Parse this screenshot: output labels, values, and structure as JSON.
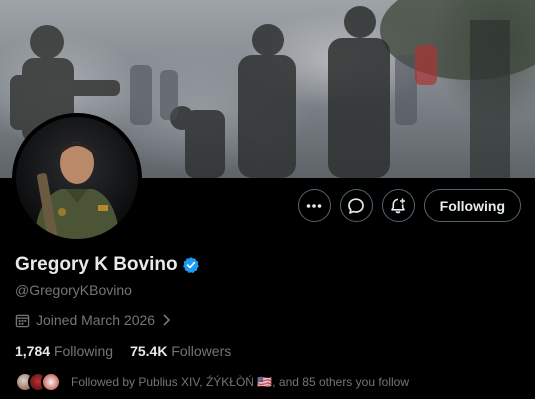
{
  "header": {
    "banner_icon": "banner-photo",
    "avatar_icon": "profile-photo"
  },
  "actions": {
    "more_icon": "more-icon",
    "message_icon": "message-icon",
    "notify_icon": "notification-add-icon",
    "following_label": "Following"
  },
  "profile": {
    "display_name": "Gregory K Bovino",
    "verified_icon": "verified-badge-icon",
    "handle": "@GregoryKBovino",
    "joined": "Joined March 2026",
    "following_count": "1,784",
    "following_label": "Following",
    "followers_count": "75.4K",
    "followers_label": "Followers",
    "followed_by": "Followed by Publius XIV, ŹÝKŁÒŃ 🇺🇸, and 85 others you follow"
  },
  "colors": {
    "background": "#000000",
    "primary_text": "#e7e9ea",
    "secondary_text": "#71767b",
    "verified": "#1d9bf0",
    "border": "#536471"
  }
}
